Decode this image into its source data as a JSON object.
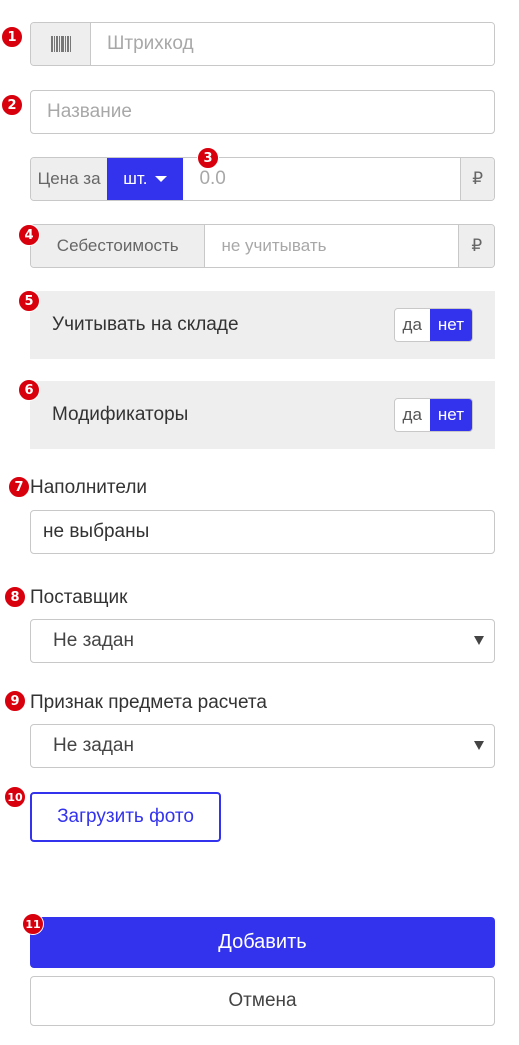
{
  "badges": [
    "1",
    "2",
    "3",
    "4",
    "5",
    "6",
    "7",
    "8",
    "9",
    "10",
    "11"
  ],
  "barcode": {
    "placeholder": "Штрихкод",
    "icon": "barcode-icon"
  },
  "name": {
    "placeholder": "Название"
  },
  "price": {
    "prefix": "Цена за",
    "unit": "шт.",
    "placeholder": "0.0",
    "currency": "₽"
  },
  "cost": {
    "prefix": "Себестоимость",
    "placeholder": "не учитывать",
    "currency": "₽"
  },
  "stock": {
    "label": "Учитывать на складе",
    "yes": "да",
    "no": "нет",
    "selected": "нет"
  },
  "modifiers": {
    "label": "Модификаторы",
    "yes": "да",
    "no": "нет",
    "selected": "нет"
  },
  "fillers": {
    "label": "Наполнители",
    "value": "не выбраны"
  },
  "supplier": {
    "label": "Поставщик",
    "value": "Не задан"
  },
  "calc_item": {
    "label": "Признак предмета расчета",
    "value": "Не задан"
  },
  "upload": {
    "label": "Загрузить фото"
  },
  "actions": {
    "add": "Добавить",
    "cancel": "Отмена"
  },
  "colors": {
    "accent": "#3333ee",
    "badge": "#d9000d",
    "addon_bg": "#eeeeee"
  }
}
